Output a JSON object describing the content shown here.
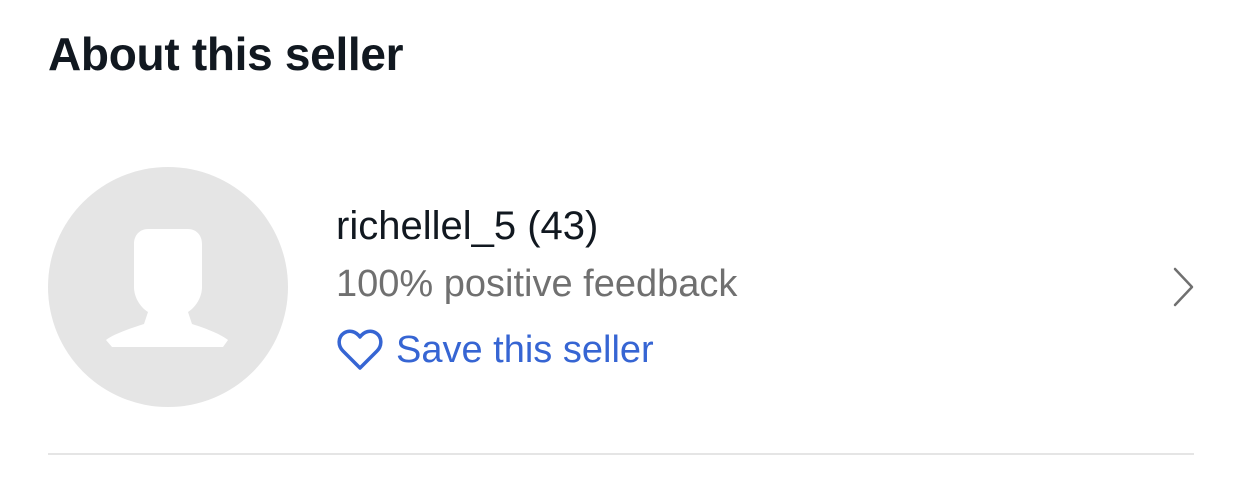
{
  "section": {
    "title": "About this seller"
  },
  "seller": {
    "username": "richellel_5",
    "feedback_count": "(43)",
    "name_display": "richellel_5 (43)",
    "feedback_text": "100% positive feedback",
    "save_label": "Save this seller",
    "avatar_icon": "default-person-avatar-icon",
    "heart_icon": "heart-outline-icon",
    "chevron_icon": "chevron-right-icon"
  },
  "colors": {
    "heading": "#111820",
    "secondary_text": "#707070",
    "link": "#3665d3",
    "avatar_bg": "#e5e5e5",
    "avatar_fg": "#ffffff",
    "divider": "#e5e5e5"
  }
}
